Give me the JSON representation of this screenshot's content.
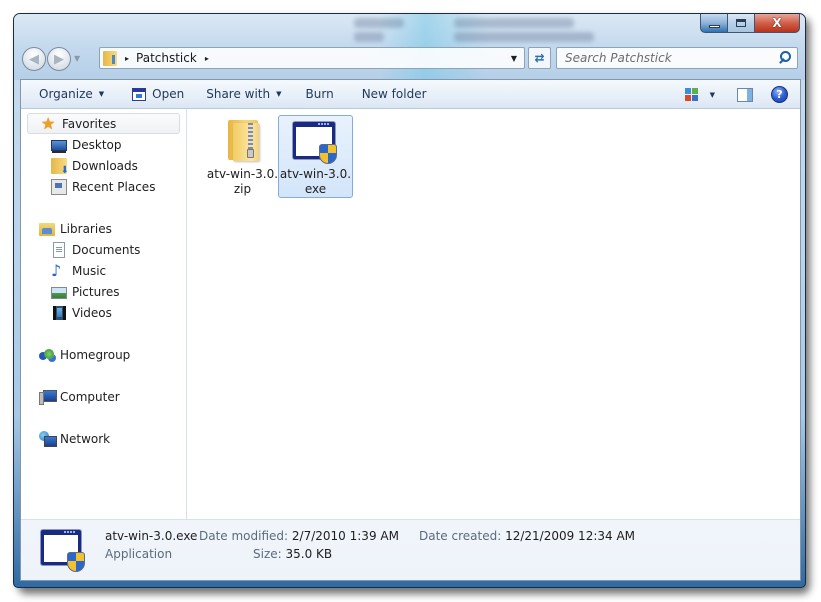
{
  "window": {
    "caption_buttons": {
      "minimize": "minimize",
      "maximize": "maximize",
      "close": "X"
    }
  },
  "navigation": {
    "back_icon": "back-arrow-icon",
    "forward_icon": "forward-arrow-icon",
    "breadcrumb": [
      "Patchstick"
    ],
    "separator": "▸",
    "search_placeholder": "Search Patchstick"
  },
  "toolbar": {
    "organize": "Organize",
    "open": "Open",
    "share_with": "Share with",
    "burn": "Burn",
    "new_folder": "New folder",
    "caret": "▼",
    "help": "?"
  },
  "sidebar": {
    "favorites": {
      "label": "Favorites",
      "items": [
        {
          "label": "Desktop",
          "icon": "desktop-icon"
        },
        {
          "label": "Downloads",
          "icon": "downloads-icon"
        },
        {
          "label": "Recent Places",
          "icon": "recent-places-icon"
        }
      ]
    },
    "libraries": {
      "label": "Libraries",
      "items": [
        {
          "label": "Documents",
          "icon": "documents-icon"
        },
        {
          "label": "Music",
          "icon": "music-icon"
        },
        {
          "label": "Pictures",
          "icon": "pictures-icon"
        },
        {
          "label": "Videos",
          "icon": "videos-icon"
        }
      ]
    },
    "homegroup": {
      "label": "Homegroup"
    },
    "computer": {
      "label": "Computer"
    },
    "network": {
      "label": "Network"
    }
  },
  "files": [
    {
      "name_line1": "atv-win-3.0.",
      "name_line2": "zip",
      "type": "zip",
      "selected": false
    },
    {
      "name_line1": "atv-win-3.0.",
      "name_line2": "exe",
      "type": "exe",
      "selected": true
    }
  ],
  "details": {
    "name": "atv-win-3.0.exe",
    "type": "Application",
    "date_modified_label": "Date modified:",
    "date_modified": "2/7/2010 1:39 AM",
    "date_created_label": "Date created:",
    "date_created": "12/21/2009 12:34 AM",
    "size_label": "Size:",
    "size": "35.0 KB"
  }
}
